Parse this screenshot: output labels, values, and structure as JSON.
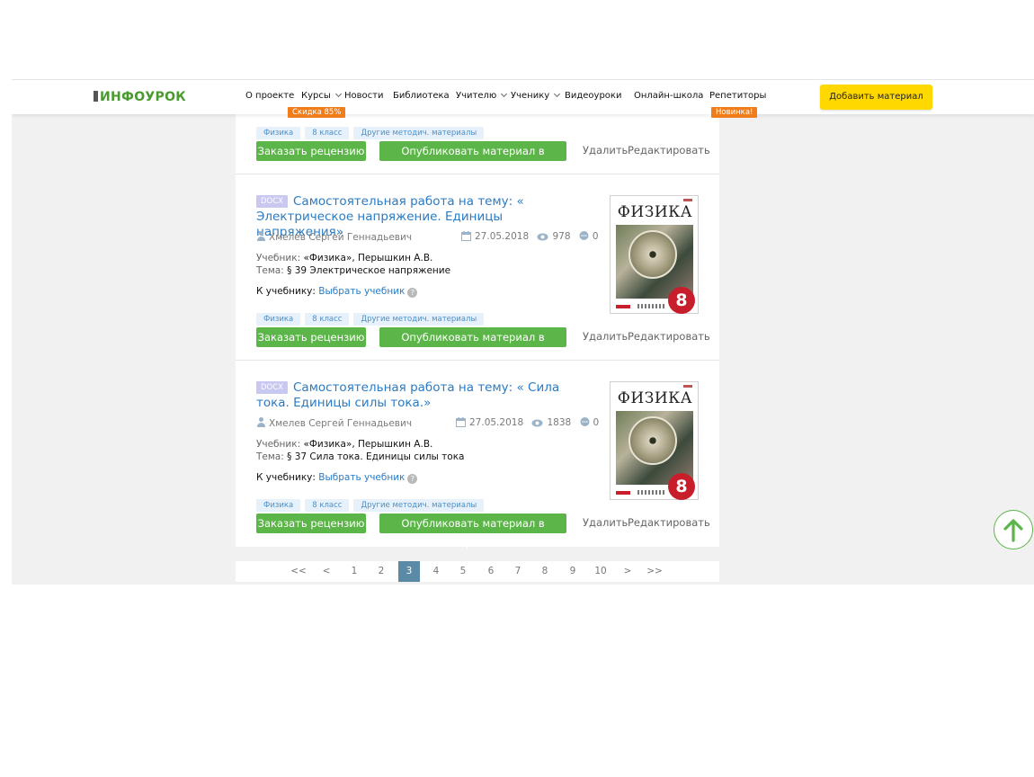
{
  "header": {
    "logo_text": "ИНФОУРОК",
    "nav": [
      {
        "label": "О проекте"
      },
      {
        "label": "Курсы",
        "badge": "Скидка 85%"
      },
      {
        "label": "Новости"
      },
      {
        "label": "Библиотека"
      },
      {
        "label": "Учителю"
      },
      {
        "label": "Ученику"
      },
      {
        "label": "Видеоуроки"
      },
      {
        "label": "Онлайн-школа"
      },
      {
        "label": "Репетиторы",
        "badge": "Новинка!"
      }
    ],
    "add_button": "Добавить материал"
  },
  "top_fragment": {
    "tags": [
      "Физика",
      "8 класс",
      "Другие методич. материалы"
    ],
    "order_review": "Заказать рецензию",
    "publish": "Опубликовать материал в сборнике",
    "delete": "Удалить",
    "edit": "Редактировать"
  },
  "items": [
    {
      "badge": "DOCX",
      "title": "Самостоятельная работа на тему: « Электрическое напряжение. Единицы напряжения»",
      "author": "Хмелев Сергей Геннадьевич",
      "date": "27.05.2018",
      "views": "978",
      "comments": "0",
      "textbook_label": "Учебник:",
      "textbook_value": "«Физика», Перышкин А.В.",
      "topic_label": "Тема:",
      "topic_value": "§ 39 Электрическое напряжение",
      "to_textbook_label": "К учебнику:",
      "choose_textbook": "Выбрать учебник",
      "tags": [
        "Физика",
        "8 класс",
        "Другие методич. материалы"
      ],
      "order_review": "Заказать рецензию",
      "publish": "Опубликовать материал в сборнике",
      "delete": "Удалить",
      "edit": "Редактировать",
      "cover_title": "ФИЗИКА",
      "cover_grade": "8"
    },
    {
      "badge": "DOCX",
      "title": "Самостоятельная работа на тему: « Сила тока. Единицы силы тока.»",
      "author": "Хмелев Сергей Геннадьевич",
      "date": "27.05.2018",
      "views": "1838",
      "comments": "0",
      "textbook_label": "Учебник:",
      "textbook_value": "«Физика», Перышкин А.В.",
      "topic_label": "Тема:",
      "topic_value": "§ 37 Сила тока. Единицы силы тока",
      "to_textbook_label": "К учебнику:",
      "choose_textbook": "Выбрать учебник",
      "tags": [
        "Физика",
        "8 класс",
        "Другие методич. материалы"
      ],
      "order_review": "Заказать рецензию",
      "publish": "Опубликовать материал в сборнике",
      "delete": "Удалить",
      "edit": "Редактировать",
      "cover_title": "ФИЗИКА",
      "cover_grade": "8"
    }
  ],
  "pagination": {
    "items": [
      "<<",
      "<",
      "1",
      "2",
      "3",
      "4",
      "5",
      "6",
      "7",
      "8",
      "9",
      "10",
      ">",
      ">>"
    ],
    "current": "3"
  },
  "icons": {
    "scroll_up": "arrow-up-icon",
    "author": "person-icon",
    "date": "calendar-icon",
    "views": "eye-icon",
    "comments": "comment-icon",
    "help": "question-icon"
  },
  "colors": {
    "brand_green": "#5cb548",
    "link_blue": "#2a7bc4",
    "add_button": "#ffd800",
    "badge_orange": "#f07d1a",
    "pager_active": "#5b8aa6"
  }
}
